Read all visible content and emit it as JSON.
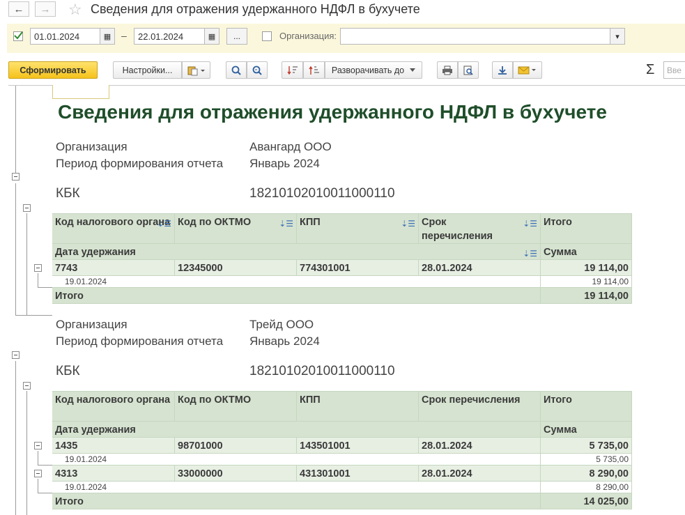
{
  "window": {
    "title": "Сведения для отражения удержанного НДФЛ в бухучете",
    "back": "←",
    "forward": "→",
    "star": "☆"
  },
  "filter": {
    "date_from": "01.01.2024",
    "date_to": "22.01.2024",
    "dash": "–",
    "more": "...",
    "org_label": "Организация:",
    "org_value": "",
    "cal_icon": "▦",
    "dropdown_icon": "▾"
  },
  "toolbar": {
    "generate": "Сформировать",
    "settings": "Настройки...",
    "expand_to": "Разворачивать до",
    "sigma": "Σ",
    "search_placeholder": "Вве"
  },
  "report": {
    "title": "Сведения для отражения удержанного НДФЛ в бухучете",
    "columns": {
      "tax_office": "Код налогового органа",
      "oktmo": "Код по ОКТМО",
      "kpp": "КПП",
      "due": "Срок перечисления",
      "total": "Итого",
      "date_withheld": "Дата удержания",
      "amount": "Сумма",
      "total_row": "Итого"
    },
    "labels": {
      "org": "Организация",
      "period": "Период формирования отчета",
      "kbk": "КБК"
    },
    "sections": [
      {
        "org": "Авангард ООО",
        "period": "Январь 2024",
        "kbk": "18210102010011000110",
        "rows": [
          {
            "tax_office": "7743",
            "oktmo": "12345000",
            "kpp": "774301001",
            "due": "28.01.2024",
            "total": "19 114,00",
            "detail_date": "19.01.2024",
            "detail_amount": "19 114,00"
          }
        ],
        "grand_total": "19 114,00"
      },
      {
        "org": "Трейд ООО",
        "period": "Январь 2024",
        "kbk": "18210102010011000110",
        "rows": [
          {
            "tax_office": "1435",
            "oktmo": "98701000",
            "kpp": "143501001",
            "due": "28.01.2024",
            "total": "5 735,00",
            "detail_date": "19.01.2024",
            "detail_amount": "5 735,00"
          },
          {
            "tax_office": "4313",
            "oktmo": "33000000",
            "kpp": "431301001",
            "due": "28.01.2024",
            "total": "8 290,00",
            "detail_date": "19.01.2024",
            "detail_amount": "8 290,00"
          }
        ],
        "grand_total": "14 025,00"
      }
    ]
  }
}
